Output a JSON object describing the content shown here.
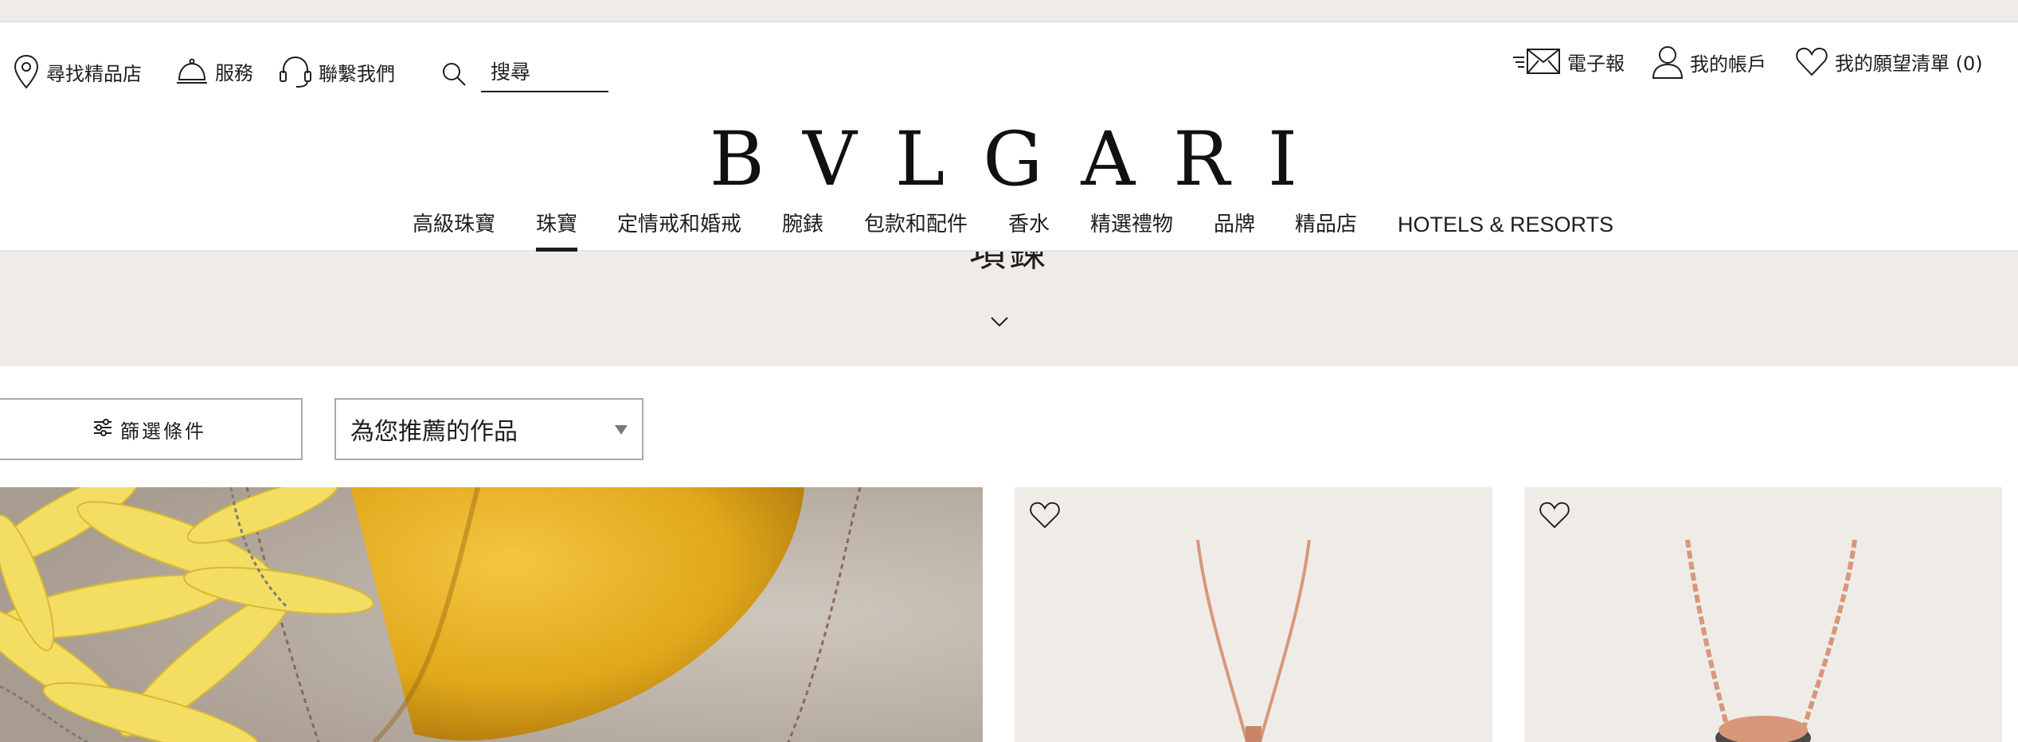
{
  "header": {
    "find_store": "尋找精品店",
    "services": "服務",
    "contact": "聯繫我們",
    "search_placeholder": "搜尋",
    "newsletter": "電子報",
    "account": "我的帳戶",
    "wishlist": "我的願望清單 (0)",
    "logo": "BVLGARI"
  },
  "nav": {
    "items": [
      {
        "label": "高級珠寶"
      },
      {
        "label": "珠寶",
        "active": true
      },
      {
        "label": "定情戒和婚戒"
      },
      {
        "label": "腕錶"
      },
      {
        "label": "包款和配件"
      },
      {
        "label": "香水"
      },
      {
        "label": "精選禮物"
      },
      {
        "label": "品牌"
      },
      {
        "label": "精品店"
      },
      {
        "label": "HOTELS & RESORTS"
      }
    ]
  },
  "banner": {
    "title": "項鍊"
  },
  "toolbar": {
    "filter_label": "篩選條件",
    "sort_label": "為您推薦的作品"
  },
  "colors": {
    "accent": "#1e1e1e",
    "beige": "#efece8",
    "rose_gold": "#d9977a"
  },
  "icons": [
    "location-pin-icon",
    "service-bell-icon",
    "headset-icon",
    "search-icon",
    "envelope-icon",
    "user-icon",
    "heart-icon",
    "chevron-down-icon",
    "sliders-icon"
  ]
}
